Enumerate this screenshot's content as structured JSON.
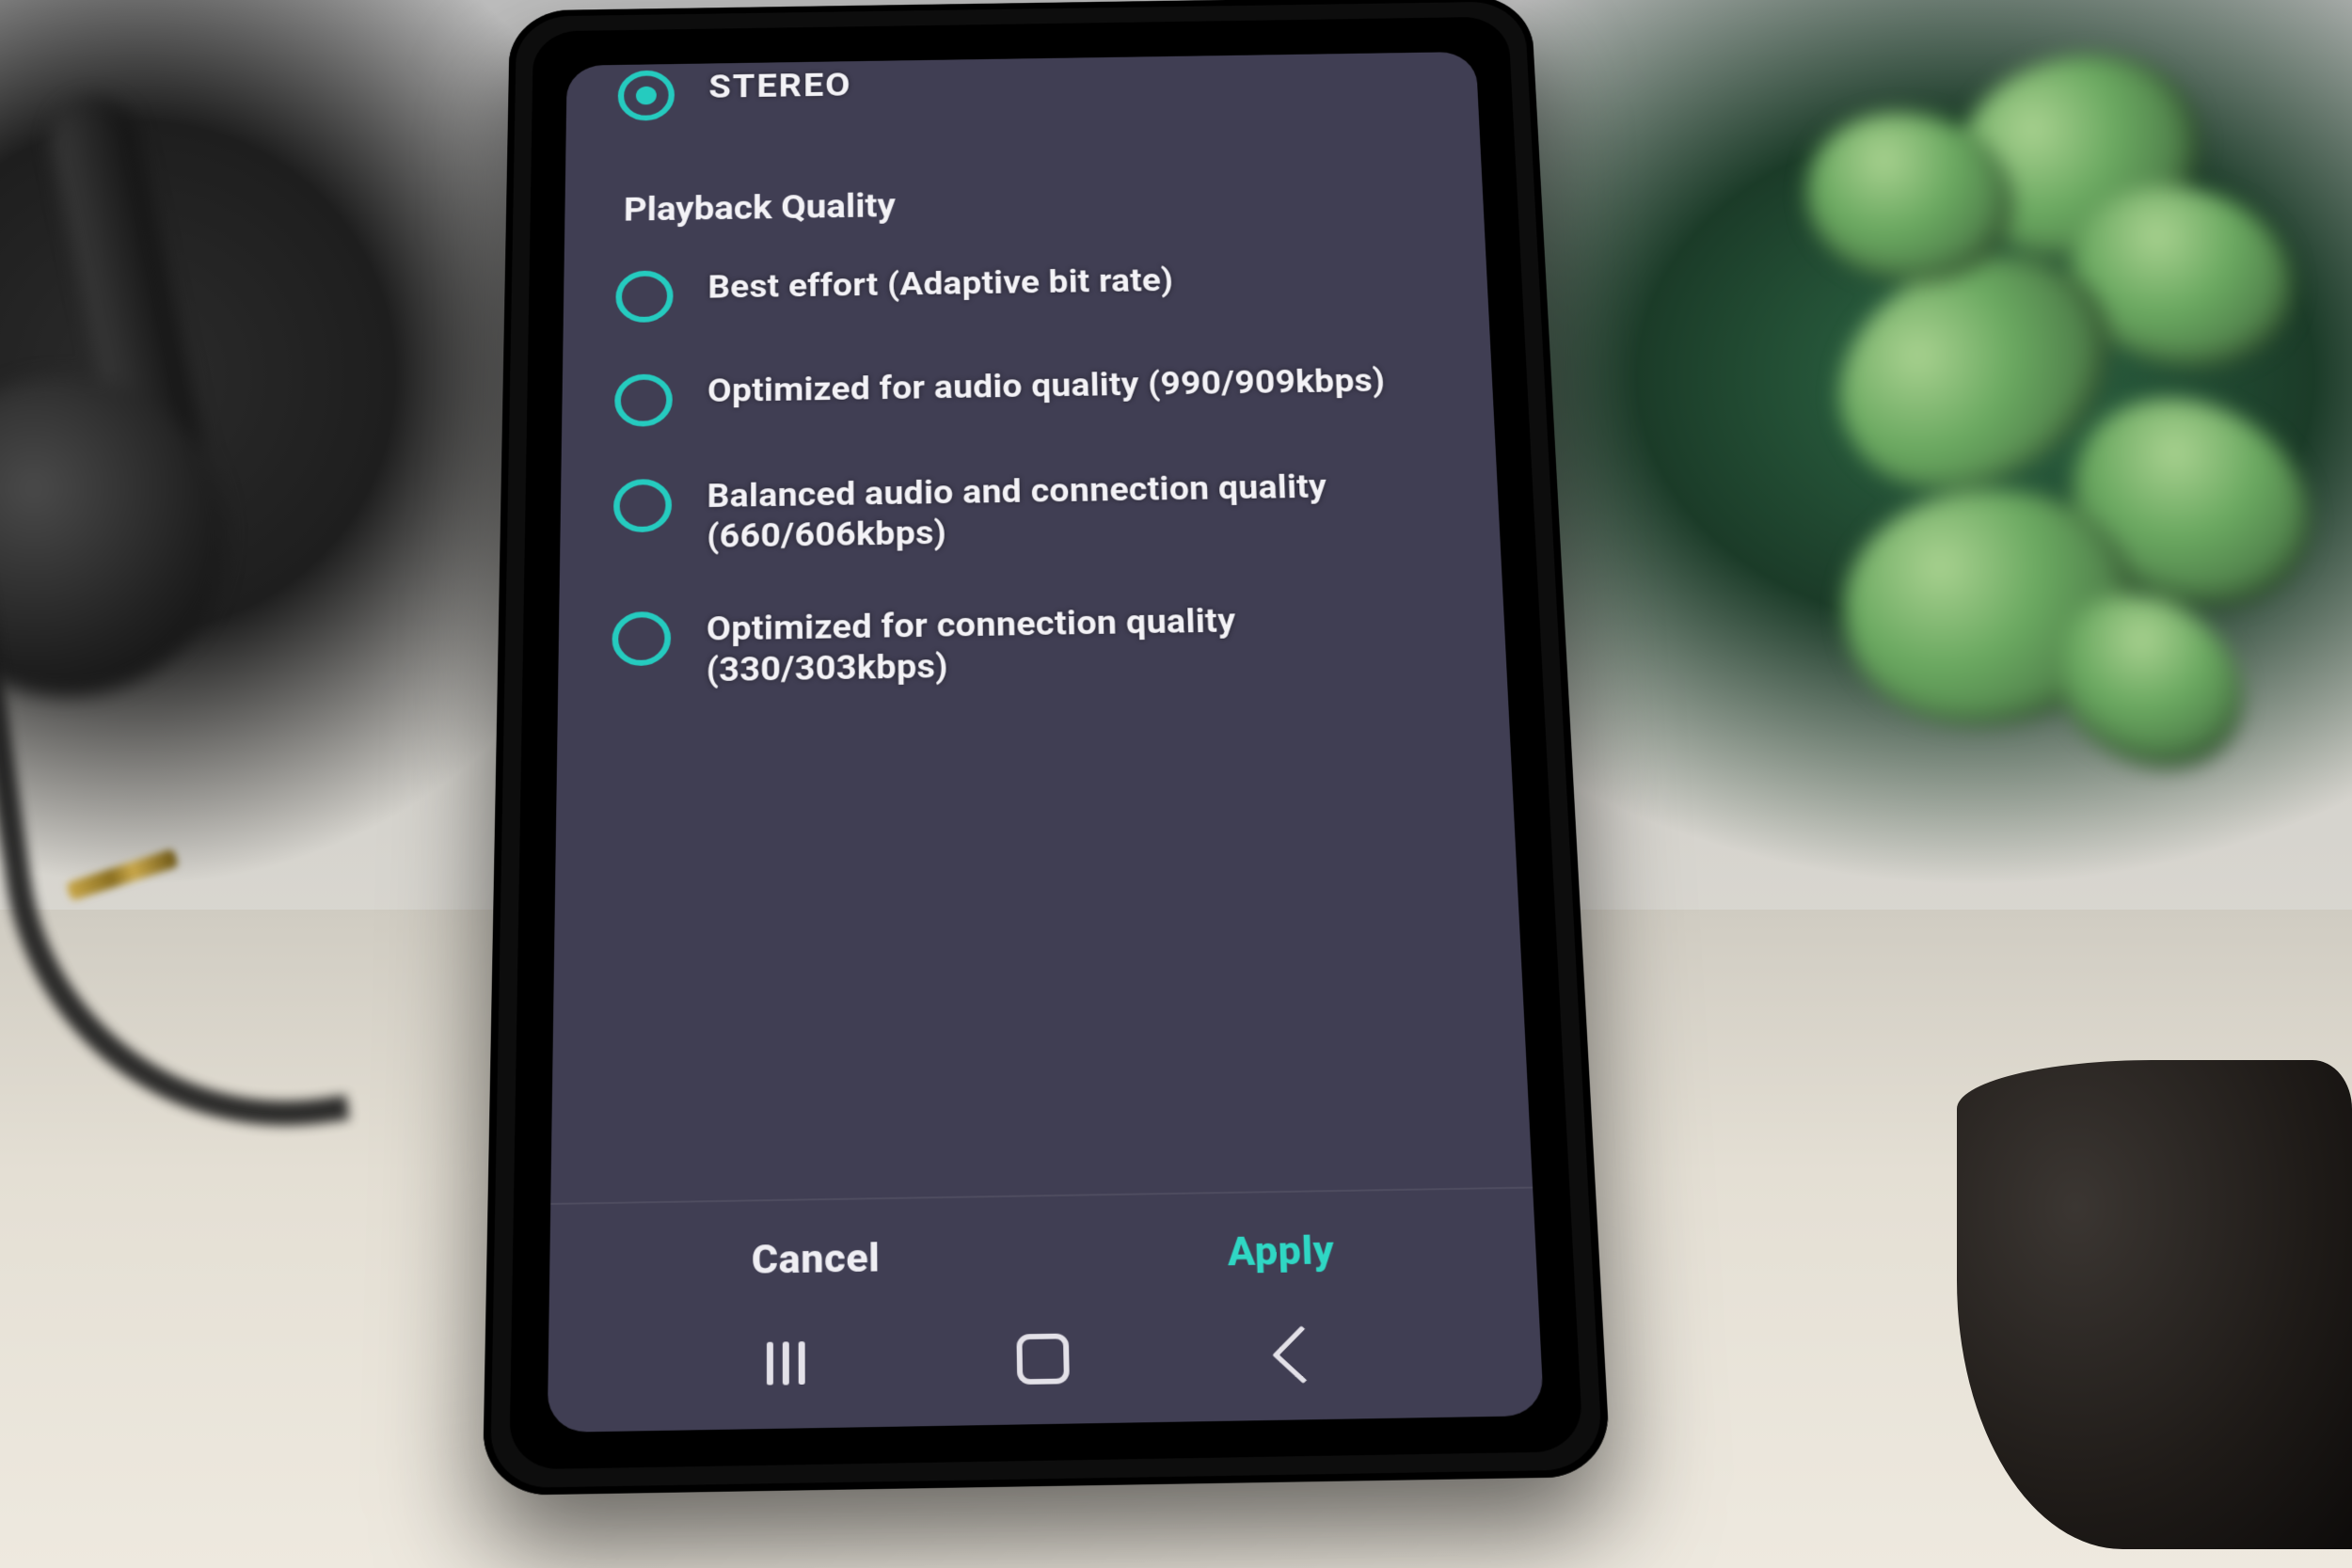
{
  "channel": {
    "options": [
      {
        "label": "STEREO",
        "selected": true
      }
    ]
  },
  "playback": {
    "title": "Playback Quality",
    "options": [
      {
        "label": "Best effort (Adaptive bit rate)",
        "selected": false
      },
      {
        "label": "Optimized for audio quality (990/909kbps)",
        "selected": false
      },
      {
        "label": "Balanced audio and connection quality (660/606kbps)",
        "selected": false
      },
      {
        "label": "Optimized for connection quality (330/303kbps)",
        "selected": false
      }
    ]
  },
  "footer": {
    "cancel": "Cancel",
    "apply": "Apply"
  },
  "colors": {
    "accent": "#25cbbf",
    "screen_bg": "#403e53"
  }
}
